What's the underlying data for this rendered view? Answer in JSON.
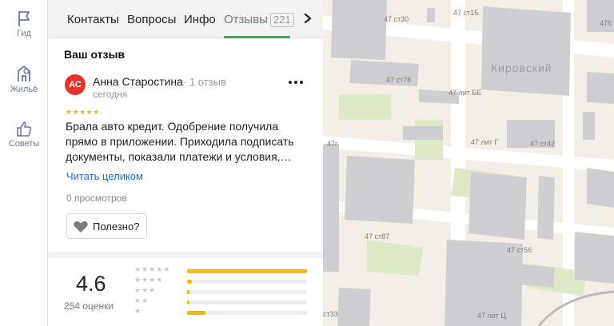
{
  "rail": {
    "items": [
      {
        "label": "Гид",
        "icon": "flag-icon"
      },
      {
        "label": "Жильё",
        "icon": "building-icon"
      },
      {
        "label": "Советы",
        "icon": "thumbs-up-icon"
      }
    ]
  },
  "tabs": [
    {
      "label": "Контакты"
    },
    {
      "label": "Вопросы"
    },
    {
      "label": "Инфо"
    },
    {
      "label": "Отзывы",
      "badge": "221",
      "active": true
    }
  ],
  "review": {
    "section_title": "Ваш отзыв",
    "avatar_initials": "АС",
    "avatar_color": "#e5322b",
    "author": "Анна Старостина",
    "author_reviews": "· 1 отзыв",
    "date": "сегодня",
    "stars": "★★★★★",
    "text": "Брала авто кредит. Одобрение получила прямо в приложении. Приходила подписать документы, показали платежи и условия,…",
    "read_more": "Читать целиком",
    "views": "0 просмотров",
    "useful_label": "Полезно?"
  },
  "rating": {
    "value": "4.6",
    "count_label": "254 оценки",
    "distribution": [
      {
        "stars": "★★★★★",
        "fraction": 1.0
      },
      {
        "stars": "★★★★",
        "fraction": 0.04
      },
      {
        "stars": "★★★",
        "fraction": 0.02
      },
      {
        "stars": "★★",
        "fraction": 0.01
      },
      {
        "stars": "★",
        "fraction": 0.15
      }
    ]
  },
  "map": {
    "district": "Кировский",
    "labels": [
      "47 ст30",
      "47 ст15",
      "476",
      "47 ст76",
      "47 лит БЕ",
      "47г",
      "47 лит Г",
      "47 ст42",
      "47 ст87",
      "47 ст56",
      "ст33",
      "47 лит Ц"
    ]
  },
  "colors": {
    "accent_green": "#2bb24c",
    "star_yellow": "#f6b700",
    "link_blue": "#1a6ccf"
  }
}
